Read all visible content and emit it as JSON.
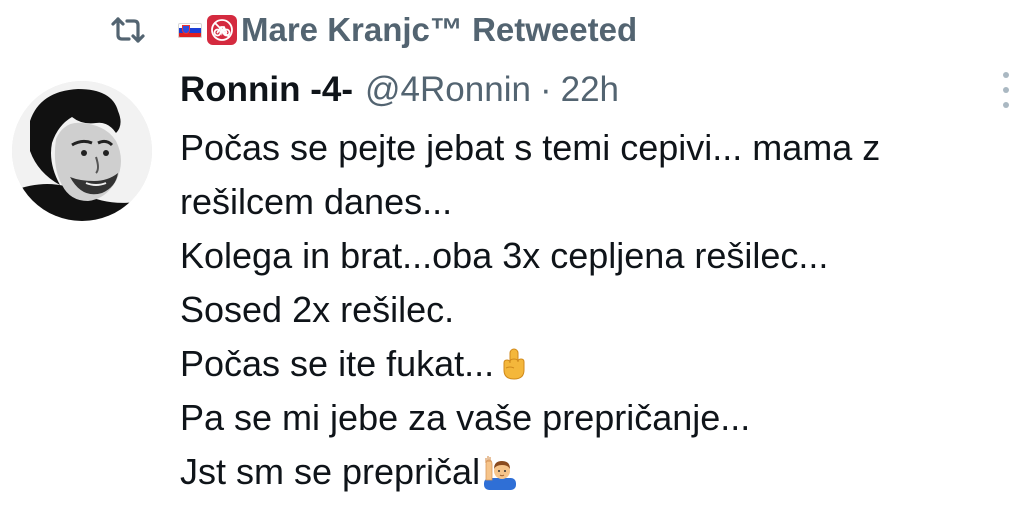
{
  "retweet": {
    "icon": "retweet-icon",
    "flag_icon": "slovenia-flag-icon",
    "badge_icon": "no-bicycles-icon",
    "label": "Mare Kranjc™ Retweeted"
  },
  "tweet": {
    "author": {
      "display_name": "Ronnin -4-",
      "handle": "@4Ronnin",
      "separator": "·",
      "time": "22h"
    },
    "more_icon": "more-vertical-icon",
    "lines": [
      "Počas se pejte jebat s temi cepivi... mama z",
      "rešilcem danes...",
      "Kolega in brat...oba 3x cepljena rešilec...",
      "Sosed 2x rešilec.",
      "Počas se ite fukat...",
      "Pa se mi jebe za vaše prepričanje...",
      "Jst sm se prepričal"
    ],
    "emojis": {
      "line5": "middle-finger-emoji",
      "line7": "person-raising-hand-emoji"
    }
  },
  "colors": {
    "text_primary": "#0f1419",
    "text_secondary": "#536471",
    "badge_red": "#d42a3f",
    "background": "#ffffff"
  }
}
